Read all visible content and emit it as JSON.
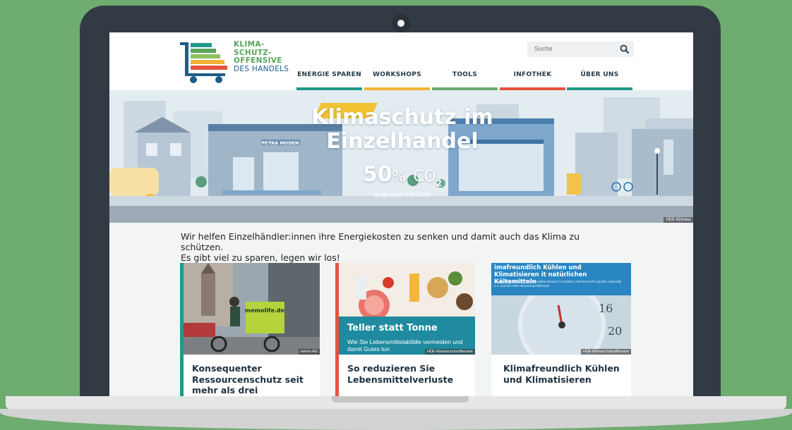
{
  "logo": {
    "line1": "KLIMA-",
    "line2": "SCHUTZ-",
    "line3": "OFFENSIVE",
    "line4": "DES HANDELS"
  },
  "search": {
    "placeholder": "Suche",
    "icon": "search-icon"
  },
  "nav": {
    "items": [
      {
        "label": "ENERGIE SPAREN",
        "color": "#1e9a8a"
      },
      {
        "label": "WORKSHOPS",
        "color": "#f2b233"
      },
      {
        "label": "TOOLS",
        "color": "#6aab6e"
      },
      {
        "label": "INFOTHEK",
        "color": "#e5533c"
      },
      {
        "label": "ÜBER UNS",
        "color": "#1e9a8a"
      }
    ]
  },
  "hero": {
    "title_line1": "Klimaschutz im",
    "title_line2": "Einzelhandel",
    "stat_value": "50",
    "stat_unit": "%",
    "stat_gas": "CO",
    "stat_sub": "2",
    "caption": "eingespart seit 1990",
    "shop_sign": "PETRA MODEN",
    "credit": "HDE-Klimasc"
  },
  "intro": {
    "line1": "Wir helfen Einzelhändler:innen ihre Energiekosten zu senken und damit auch das Klima zu schützen.",
    "line2": "Es gibt viel zu sparen, legen wir los!"
  },
  "cards": [
    {
      "title": "Konsequenter Ressourcenschutz seit mehr als drei Jahrzehnten",
      "credit": "memo AG",
      "sign": "memolife.de",
      "accent": "#1e9a8a"
    },
    {
      "title": "So reduzieren Sie Lebensmittelverluste",
      "overlay_title": "Teller statt Tonne",
      "overlay_sub": "Wie Sie Lebensmittelabfälle vermeiden und damit Gutes tun",
      "credit": "HDE-Klimaschutzoffensive",
      "accent": "#e5533c"
    },
    {
      "title": "Klimafreundlich Kühlen und Klimatisieren",
      "header_title": "imafreundlich Kühlen und Klimatisieren it natürlichen Kältemitteln",
      "header_sub": "gemeinsame Initiative von Umweltbundesamt | Coolaktiv | ReFlexAir.PE igenials, Naturalfy e.V. und der HDE-Klimaschutzoffensive",
      "gauge_16": "16",
      "gauge_20": "20",
      "credit": "HDE-Klimaschutzoffensive",
      "accent": "#1e9a8a"
    }
  ]
}
